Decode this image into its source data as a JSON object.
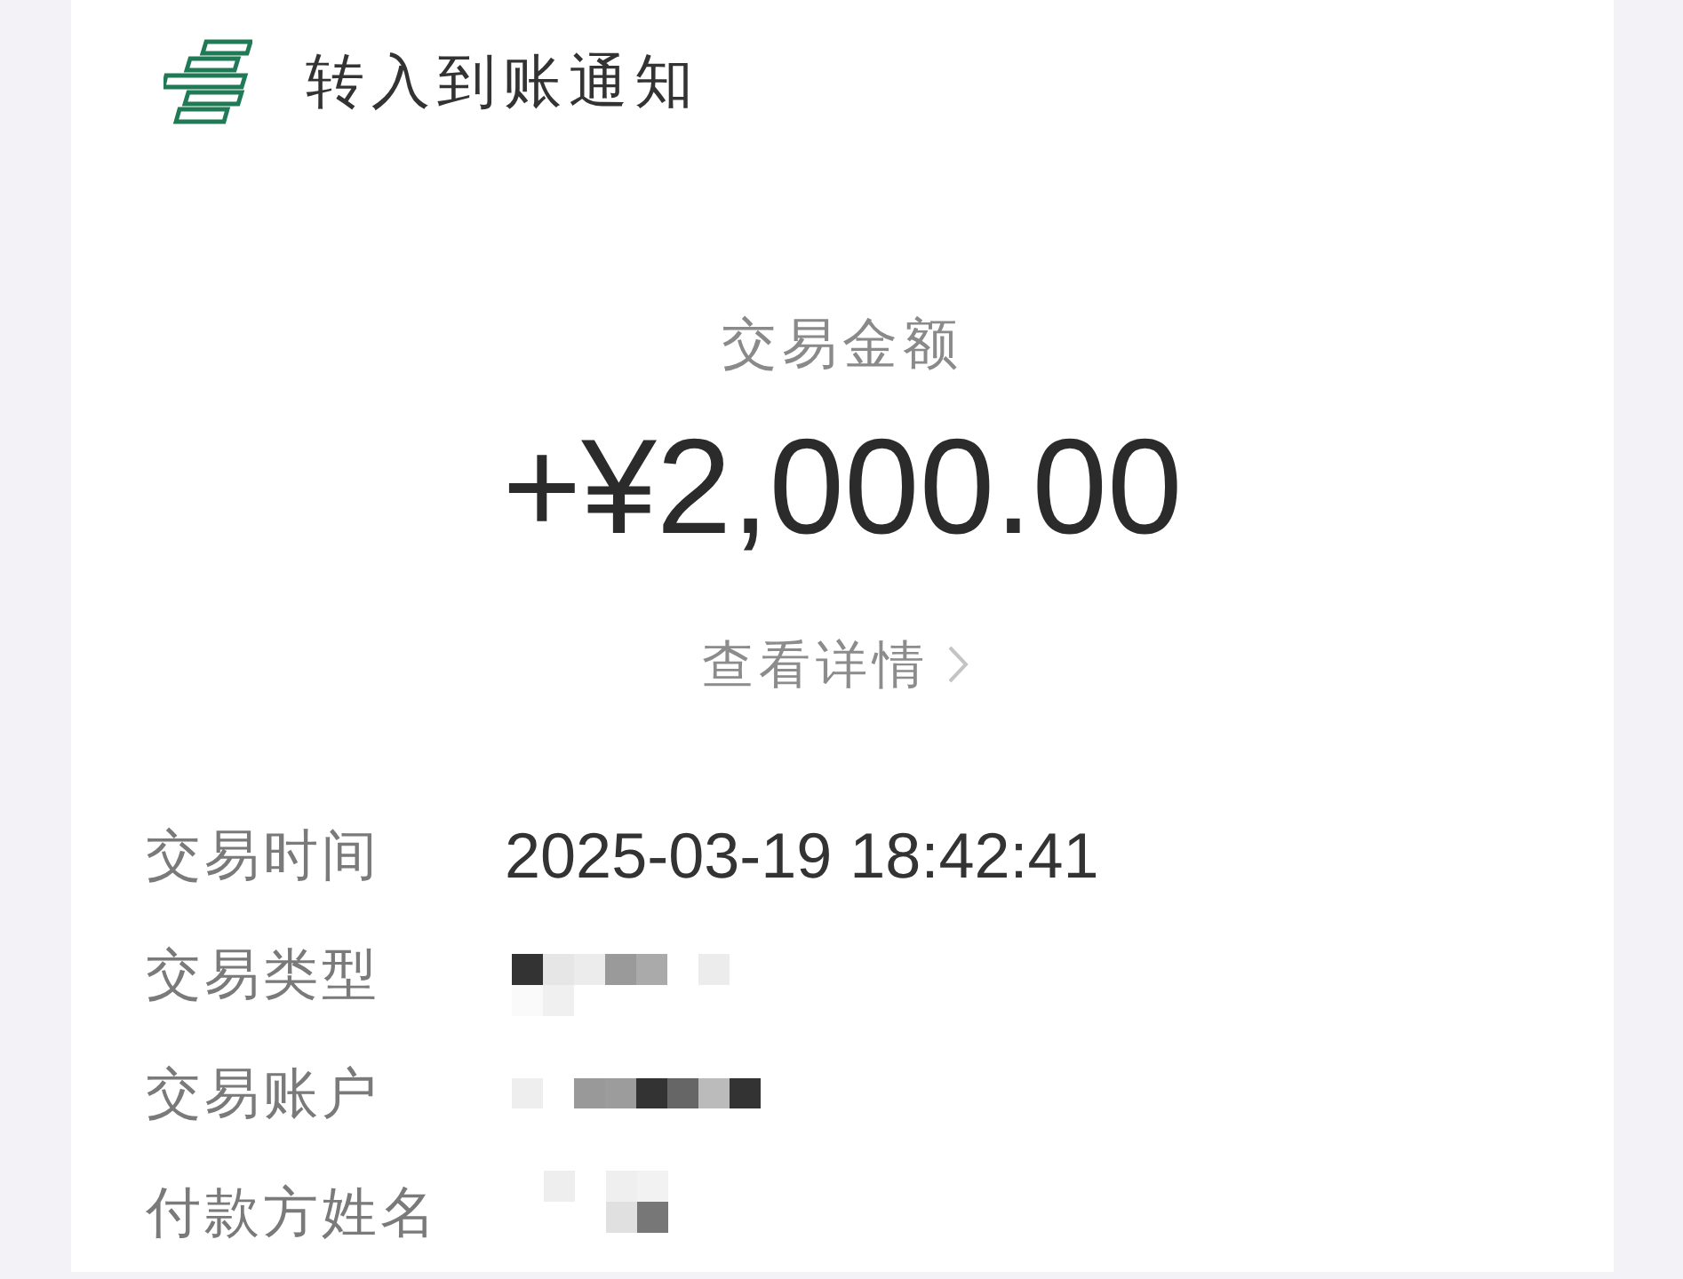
{
  "header": {
    "title": "转入到账通知"
  },
  "amount": {
    "label": "交易金额",
    "value": "+¥2,000.00"
  },
  "details_link": {
    "label": "查看详情"
  },
  "rows": [
    {
      "label": "交易时间",
      "value": "2025-03-19 18:42:41",
      "redacted": false
    },
    {
      "label": "交易类型",
      "redacted": true
    },
    {
      "label": "交易账户",
      "redacted": true
    },
    {
      "label": "付款方姓名",
      "redacted": true
    }
  ]
}
